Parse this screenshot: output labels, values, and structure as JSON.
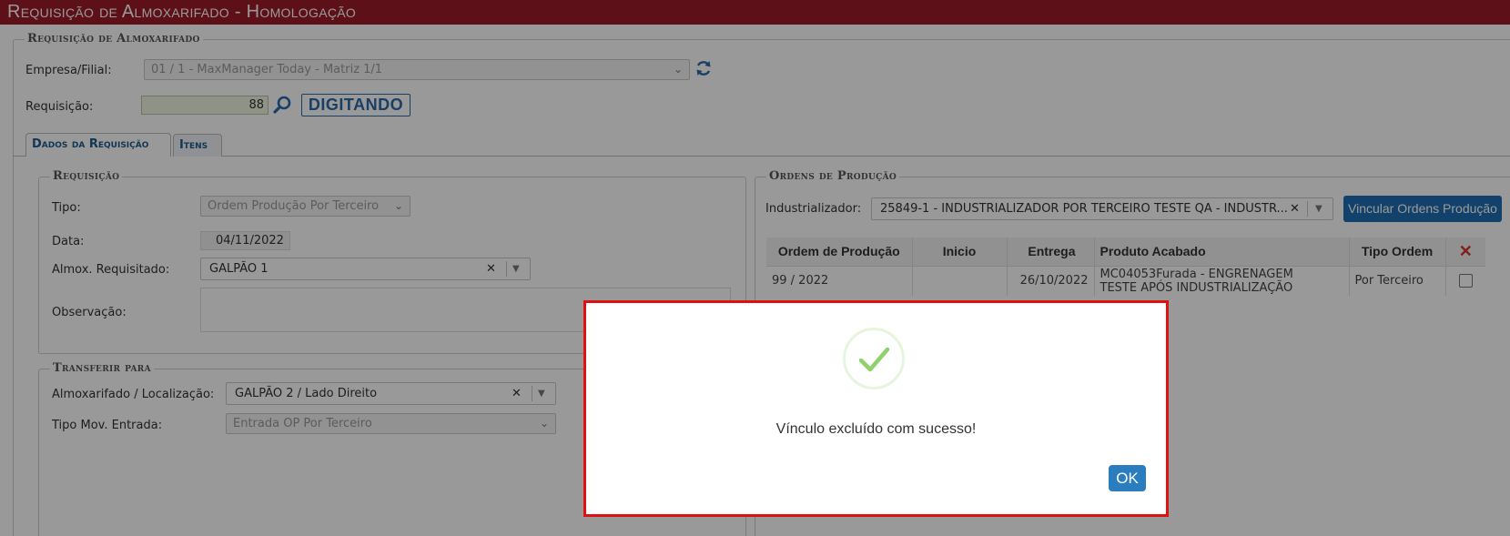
{
  "window": {
    "title": "Requisição de Almoxarifado  - Homologação"
  },
  "header_group": {
    "legend": "Requisição de Almoxarifado",
    "empresa_label": "Empresa/Filial:",
    "empresa_value": "01 / 1 - MaxManager Today - Matriz 1/1",
    "requisicao_label": "Requisição:",
    "requisicao_value": "88",
    "status": "DIGITANDO"
  },
  "tabs": [
    {
      "label": "Dados da Requisição",
      "active": true
    },
    {
      "label": "Itens",
      "active": false
    }
  ],
  "requisicao": {
    "legend": "Requisição",
    "tipo_label": "Tipo:",
    "tipo_value": "Ordem Produção Por Terceiro",
    "data_label": "Data:",
    "data_value": "04/11/2022",
    "almox_label": "Almox. Requisitado:",
    "almox_value": "GALPÃO 1",
    "observacao_label": "Observação:",
    "observacao_value": ""
  },
  "transferir": {
    "legend": "Transferir para",
    "almox_loc_label": "Almoxarifado / Localização:",
    "almox_loc_value": "GALPÃO 2 / Lado Direito",
    "tipo_mov_label": "Tipo Mov. Entrada:",
    "tipo_mov_value": "Entrada OP Por Terceiro"
  },
  "ordens": {
    "legend": "Ordens de Produção",
    "industrializador_label": "Industrializador:",
    "industrializador_value": "25849-1 - INDUSTRIALIZADOR POR TERCEIRO TESTE QA - INDUSTR...",
    "vincular_button": "Vincular Ordens Produção",
    "columns": [
      "Ordem de Produção",
      "Inicio",
      "Entrega",
      "Produto Acabado",
      "Tipo Ordem"
    ],
    "delete_header_icon": "close-icon",
    "rows": [
      {
        "ordem": "99 / 2022",
        "inicio": "",
        "entrega": "26/10/2022",
        "produto_line1": "MC04053Furada - ENGRENAGEM",
        "produto_line2": "TESTE APÓS INDUSTRIALIZAÇÃO",
        "tipo": "Por Terceiro",
        "checked": false
      }
    ]
  },
  "dialog": {
    "icon": "success-check-icon",
    "message": "Vínculo excluído com sucesso!",
    "ok_label": "OK"
  },
  "colors": {
    "title_bar": "#9b1b28",
    "accent_blue": "#1f6fb2",
    "dialog_border": "#e01010",
    "ok_button": "#2a7dbf",
    "success_check": "#8fd16a",
    "delete_red": "#d9342b"
  }
}
